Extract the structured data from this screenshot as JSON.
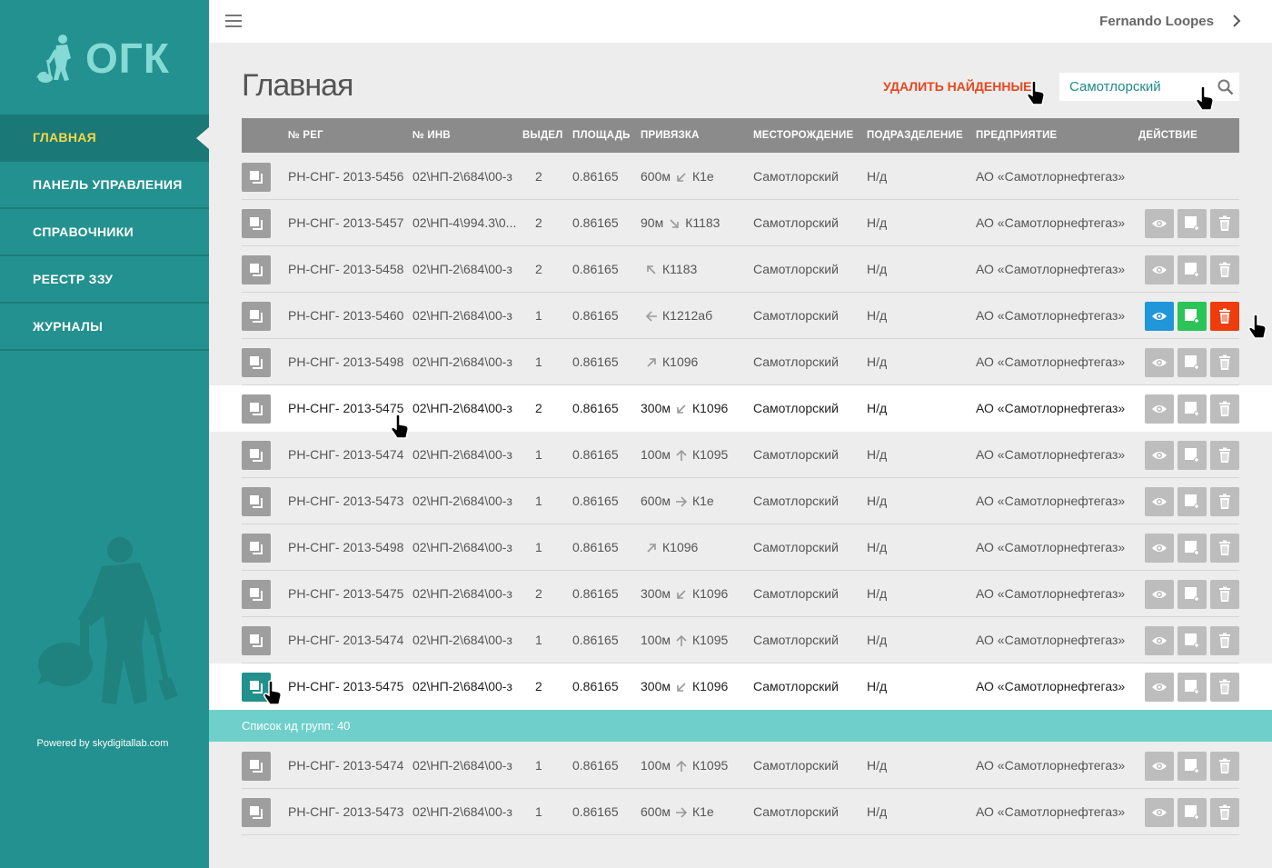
{
  "logo": {
    "text": "ОГК"
  },
  "sidebar": {
    "items": [
      {
        "label": "ГЛАВНАЯ",
        "active": true
      },
      {
        "label": "ПАНЕЛЬ УПРАВЛЕНИЯ"
      },
      {
        "label": "СПРАВОЧНИКИ"
      },
      {
        "label": "РЕЕСТР ЗЗУ"
      },
      {
        "label": "ЖУРНАЛЫ"
      }
    ],
    "powered": "Powered by skydigitallab.com"
  },
  "topbar": {
    "user": "Fernando Loopes",
    "menu_icon": "hamburger-icon",
    "chevron_icon": "chevron-right-icon"
  },
  "page": {
    "title": "Главная",
    "delete_found": "УДАЛИТЬ НАЙДЕННЫЕ"
  },
  "search": {
    "value": "Самотлорский",
    "icon": "search-icon"
  },
  "table": {
    "columns": [
      "№ РЕГ",
      "№ ИНВ",
      "ВЫДЕЛ",
      "ПЛОЩАДЬ",
      "ПРИВЯЗКА",
      "МЕСТОРОЖДЕНИЕ",
      "ПОДРАЗДЕЛЕНИЕ",
      "ПРЕДПРИЯТИЕ",
      "ДЕЙСТВИЕ"
    ],
    "rows": [
      {
        "reg": "РН-СНГ- 2013-5456",
        "inv": "02\\НП-2\\684\\00-з",
        "vydel": "2",
        "area": "0.86165",
        "dist": "600м",
        "arrow": "down-left",
        "point": "К1е",
        "field": "Самотлорский",
        "div": "Н/д",
        "company": "АО «Самотлорнефтегаз»",
        "actions": false
      },
      {
        "reg": "РН-СНГ- 2013-5457",
        "inv": "02\\НП-4\\994.3\\0...",
        "vydel": "2",
        "area": "0.86165",
        "dist": "90м",
        "arrow": "down-right",
        "point": "К1183",
        "field": "Самотлорский",
        "div": "Н/д",
        "company": "АО «Самотлорнефтегаз»",
        "actions": true
      },
      {
        "reg": "РН-СНГ- 2013-5458",
        "inv": "02\\НП-2\\684\\00-з",
        "vydel": "2",
        "area": "0.86165",
        "dist": "",
        "arrow": "up-left",
        "point": "К1183",
        "field": "Самотлорский",
        "div": "Н/д",
        "company": "АО «Самотлорнефтегаз»",
        "actions": true
      },
      {
        "reg": "РН-СНГ- 2013-5460",
        "inv": "02\\НП-2\\684\\00-з",
        "vydel": "1",
        "area": "0.86165",
        "dist": "",
        "arrow": "left",
        "point": "К1212аб",
        "field": "Самотлорский",
        "div": "Н/д",
        "company": "АО «Самотлорнефтегаз»",
        "actions": true,
        "active_actions": true
      },
      {
        "reg": "РН-СНГ- 2013-5498",
        "inv": "02\\НП-2\\684\\00-з",
        "vydel": "1",
        "area": "0.86165",
        "dist": "",
        "arrow": "up-right",
        "point": "К1096",
        "field": "Самотлорский",
        "div": "Н/д",
        "company": "АО «Самотлорнефтегаз»",
        "actions": true
      },
      {
        "reg": "РН-СНГ- 2013-5475",
        "inv": "02\\НП-2\\684\\00-з",
        "vydel": "2",
        "area": "0.86165",
        "dist": "300м",
        "arrow": "down-left",
        "point": "К1096",
        "field": "Самотлорский",
        "div": "Н/д",
        "company": "АО «Самотлорнефтегаз»",
        "actions": true,
        "highlight": true
      },
      {
        "reg": "РН-СНГ- 2013-5474",
        "inv": "02\\НП-2\\684\\00-з",
        "vydel": "1",
        "area": "0.86165",
        "dist": "100м",
        "arrow": "up",
        "point": "К1095",
        "field": "Самотлорский",
        "div": "Н/д",
        "company": "АО «Самотлорнефтегаз»",
        "actions": true
      },
      {
        "reg": "РН-СНГ- 2013-5473",
        "inv": "02\\НП-2\\684\\00-з",
        "vydel": "1",
        "area": "0.86165",
        "dist": "600м",
        "arrow": "right",
        "point": "К1е",
        "field": "Самотлорский",
        "div": "Н/д",
        "company": "АО «Самотлорнефтегаз»",
        "actions": true
      },
      {
        "reg": "РН-СНГ- 2013-5498",
        "inv": "02\\НП-2\\684\\00-з",
        "vydel": "1",
        "area": "0.86165",
        "dist": "",
        "arrow": "up-right",
        "point": "К1096",
        "field": "Самотлорский",
        "div": "Н/д",
        "company": "АО «Самотлорнефтегаз»",
        "actions": true
      },
      {
        "reg": "РН-СНГ- 2013-5475",
        "inv": "02\\НП-2\\684\\00-з",
        "vydel": "2",
        "area": "0.86165",
        "dist": "300м",
        "arrow": "down-left",
        "point": "К1096",
        "field": "Самотлорский",
        "div": "Н/д",
        "company": "АО «Самотлорнефтегаз»",
        "actions": true
      },
      {
        "reg": "РН-СНГ- 2013-5474",
        "inv": "02\\НП-2\\684\\00-з",
        "vydel": "1",
        "area": "0.86165",
        "dist": "100м",
        "arrow": "up",
        "point": "К1095",
        "field": "Самотлорский",
        "div": "Н/д",
        "company": "АО «Самотлорнефтегаз»",
        "actions": true
      },
      {
        "reg": "РН-СНГ- 2013-5475",
        "inv": "02\\НП-2\\684\\00-з",
        "vydel": "2",
        "area": "0.86165",
        "dist": "300м",
        "arrow": "down-left",
        "point": "К1096",
        "field": "Самотлорский",
        "div": "Н/д",
        "company": "АО «Самотлорнефтегаз»",
        "actions": true,
        "highlight": true,
        "checked": true
      },
      {
        "reg": "РН-СНГ- 2013-5474",
        "inv": "02\\НП-2\\684\\00-з",
        "vydel": "1",
        "area": "0.86165",
        "dist": "100м",
        "arrow": "up",
        "point": "К1095",
        "field": "Самотлорский",
        "div": "Н/д",
        "company": "АО «Самотлорнефтегаз»",
        "actions": true
      },
      {
        "reg": "РН-СНГ- 2013-5473",
        "inv": "02\\НП-2\\684\\00-з",
        "vydel": "1",
        "area": "0.86165",
        "dist": "600м",
        "arrow": "right",
        "point": "К1е",
        "field": "Самотлорский",
        "div": "Н/д",
        "company": "АО «Самотлорнефтегаз»",
        "actions": true
      }
    ]
  },
  "group_bar": {
    "label": "Список ид групп: 40"
  },
  "colors": {
    "sidebar": "#23918f",
    "accent": "#6fd0cb",
    "danger": "#ee3c0c",
    "view": "#2196d8",
    "add": "#2bc458"
  }
}
